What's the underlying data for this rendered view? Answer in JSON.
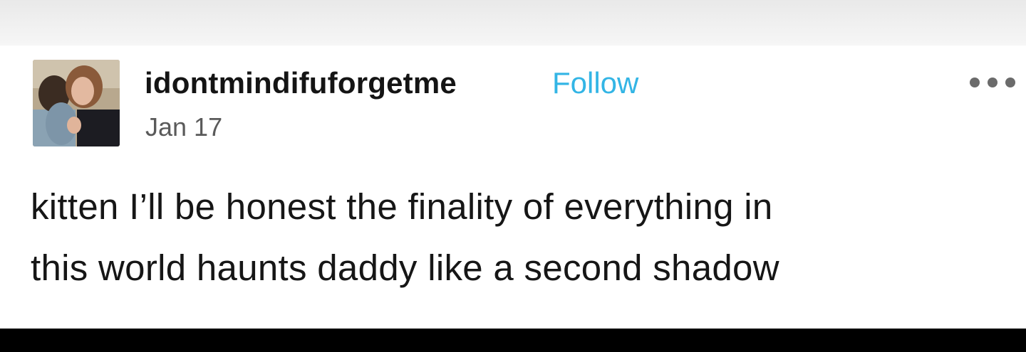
{
  "post": {
    "username": "idontmindifuforgetme",
    "follow_label": "Follow",
    "date": "Jan 17",
    "more_icon": "ellipsis-icon",
    "text_lines": [
      "kitten I’ll be honest the finality of everything in",
      "this world haunts daddy like a second shadow"
    ]
  },
  "colors": {
    "follow": "#33b5e5",
    "username": "#141414",
    "date": "#5a5a5a",
    "background": "#ffffff"
  }
}
